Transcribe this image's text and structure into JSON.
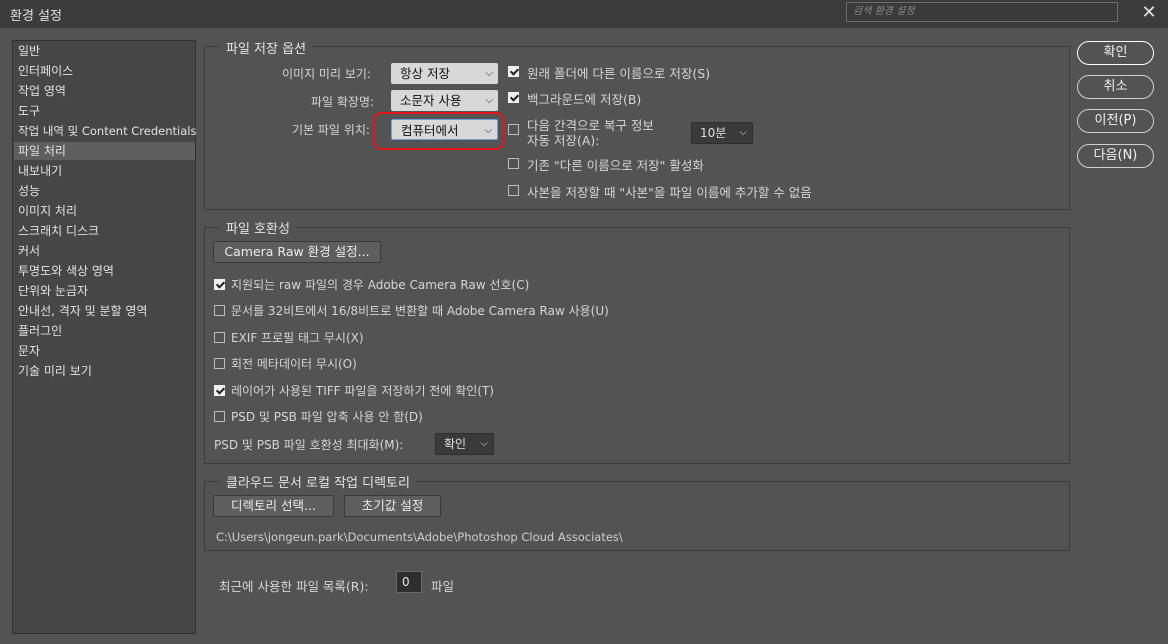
{
  "window": {
    "title": "환경 설정",
    "search_placeholder": "검색 환경 설정",
    "close_glyph": "✕"
  },
  "sidebar": {
    "items": [
      "일반",
      "인터페이스",
      "작업 영역",
      "도구",
      "작업 내역 및 Content Credentials",
      "파일 처리",
      "내보내기",
      "성능",
      "이미지 처리",
      "스크래치 디스크",
      "커서",
      "투명도와 색상 영역",
      "단위와 눈금자",
      "안내선, 격자 및 분할 영역",
      "플러그인",
      "문자",
      "기술 미리 보기"
    ],
    "selected": "파일 처리"
  },
  "file_save": {
    "title": "파일 저장 옵션",
    "image_preview_label": "이미지 미리 보기:",
    "image_preview_value": "항상 저장",
    "extension_label": "파일 확장명:",
    "extension_value": "소문자 사용",
    "default_location_label": "기본 파일 위치:",
    "default_location_value": "컴퓨터에서",
    "save_original_folder": "원래 폴더에 다른 이름으로 저장(S)",
    "save_background": "백그라운드에 저장(B)",
    "autosave_line1": "다음 간격으로 복구 정보",
    "autosave_line2": "자동 저장(A):",
    "autosave_interval": "10분",
    "legacy_save_as": "기존 \"다른 이름으로 저장\" 활성화",
    "no_copy_suffix": "사본을 저장할 때 \"사본\"을 파일 이름에 추가할 수 없음"
  },
  "compat": {
    "title": "파일 호환성",
    "camera_raw_button": "Camera Raw 환경 설정...",
    "prefer_acr": "지원되는 raw 파일의 경우 Adobe Camera Raw 선호(C)",
    "use_acr_32to16": "문서를 32비트에서 16/8비트로 변환할 때 Adobe Camera Raw 사용(U)",
    "ignore_exif": "EXIF 프로필 태그 무시(X)",
    "ignore_rotation": "회전 메타데이터 무시(O)",
    "tiff_layers_ask": "레이어가 사용된 TIFF 파일을 저장하기 전에 확인(T)",
    "disable_psd_compression": "PSD 및 PSB 파일 압축 사용 안 함(D)",
    "maximize_label": "PSD 및 PSB 파일 호환성 최대화(M):",
    "maximize_value": "확인"
  },
  "cloud": {
    "title": "클라우드 문서 로컬 작업 디렉토리",
    "choose_button": "디렉토리 선택...",
    "reset_button": "초기값 설정",
    "path": "C:\\Users\\jongeun.park\\Documents\\Adobe\\Photoshop Cloud Associates\\"
  },
  "recent": {
    "label": "최근에 사용한 파일 목록(R):",
    "value": "0",
    "unit": "파일"
  },
  "buttons": {
    "ok": "확인",
    "cancel": "취소",
    "prev": "이전(P)",
    "next": "다음(N)"
  },
  "checkbox_states": {
    "save_original_folder": true,
    "save_background": true,
    "autosave": false,
    "legacy_save_as": false,
    "no_copy_suffix": false,
    "prefer_acr": true,
    "use_acr_32to16": false,
    "ignore_exif": false,
    "ignore_rotation": false,
    "tiff_layers_ask": true,
    "disable_psd_compression": false
  },
  "colors": {
    "background": "#535353",
    "highlight_ring": "#e3141b"
  }
}
